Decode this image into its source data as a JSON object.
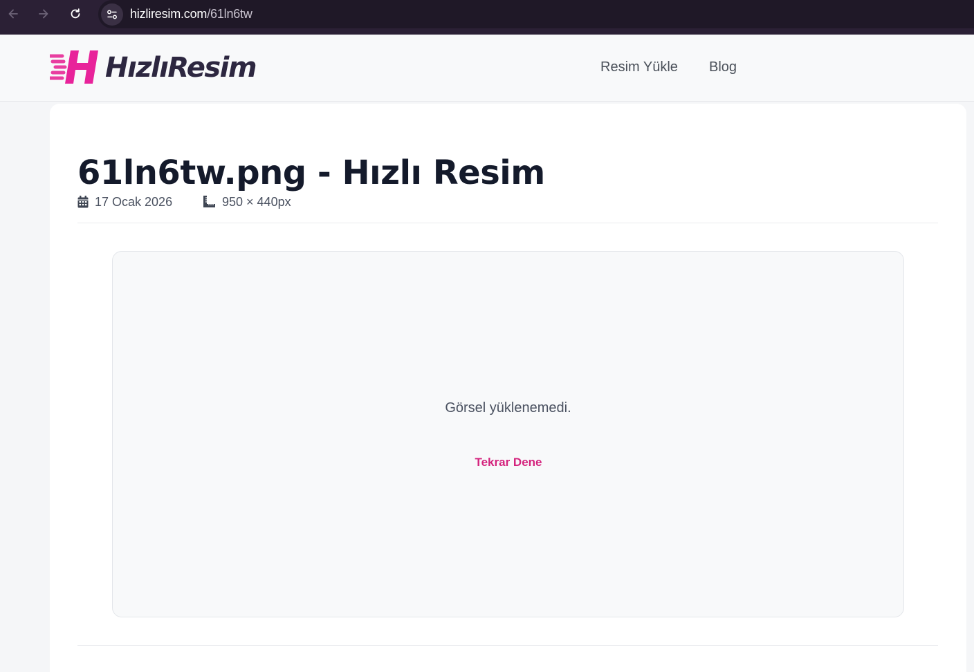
{
  "browser": {
    "url_domain": "hizliresim.com",
    "url_path": "/61ln6tw"
  },
  "header": {
    "logo_text": "HızlıResim",
    "nav": [
      "Resim Yükle",
      "Blog"
    ]
  },
  "page": {
    "title": "61ln6tw.png - Hızlı Resim",
    "date": "17 Ocak 2026",
    "dimensions": "950 × 440px"
  },
  "image_box": {
    "error_message": "Görsel yüklenemedi.",
    "retry_label": "Tekrar Dene"
  },
  "colors": {
    "brand_pink": "#d4237d",
    "logo_dark": "#2d2740",
    "browser_bar": "#2b2035"
  }
}
